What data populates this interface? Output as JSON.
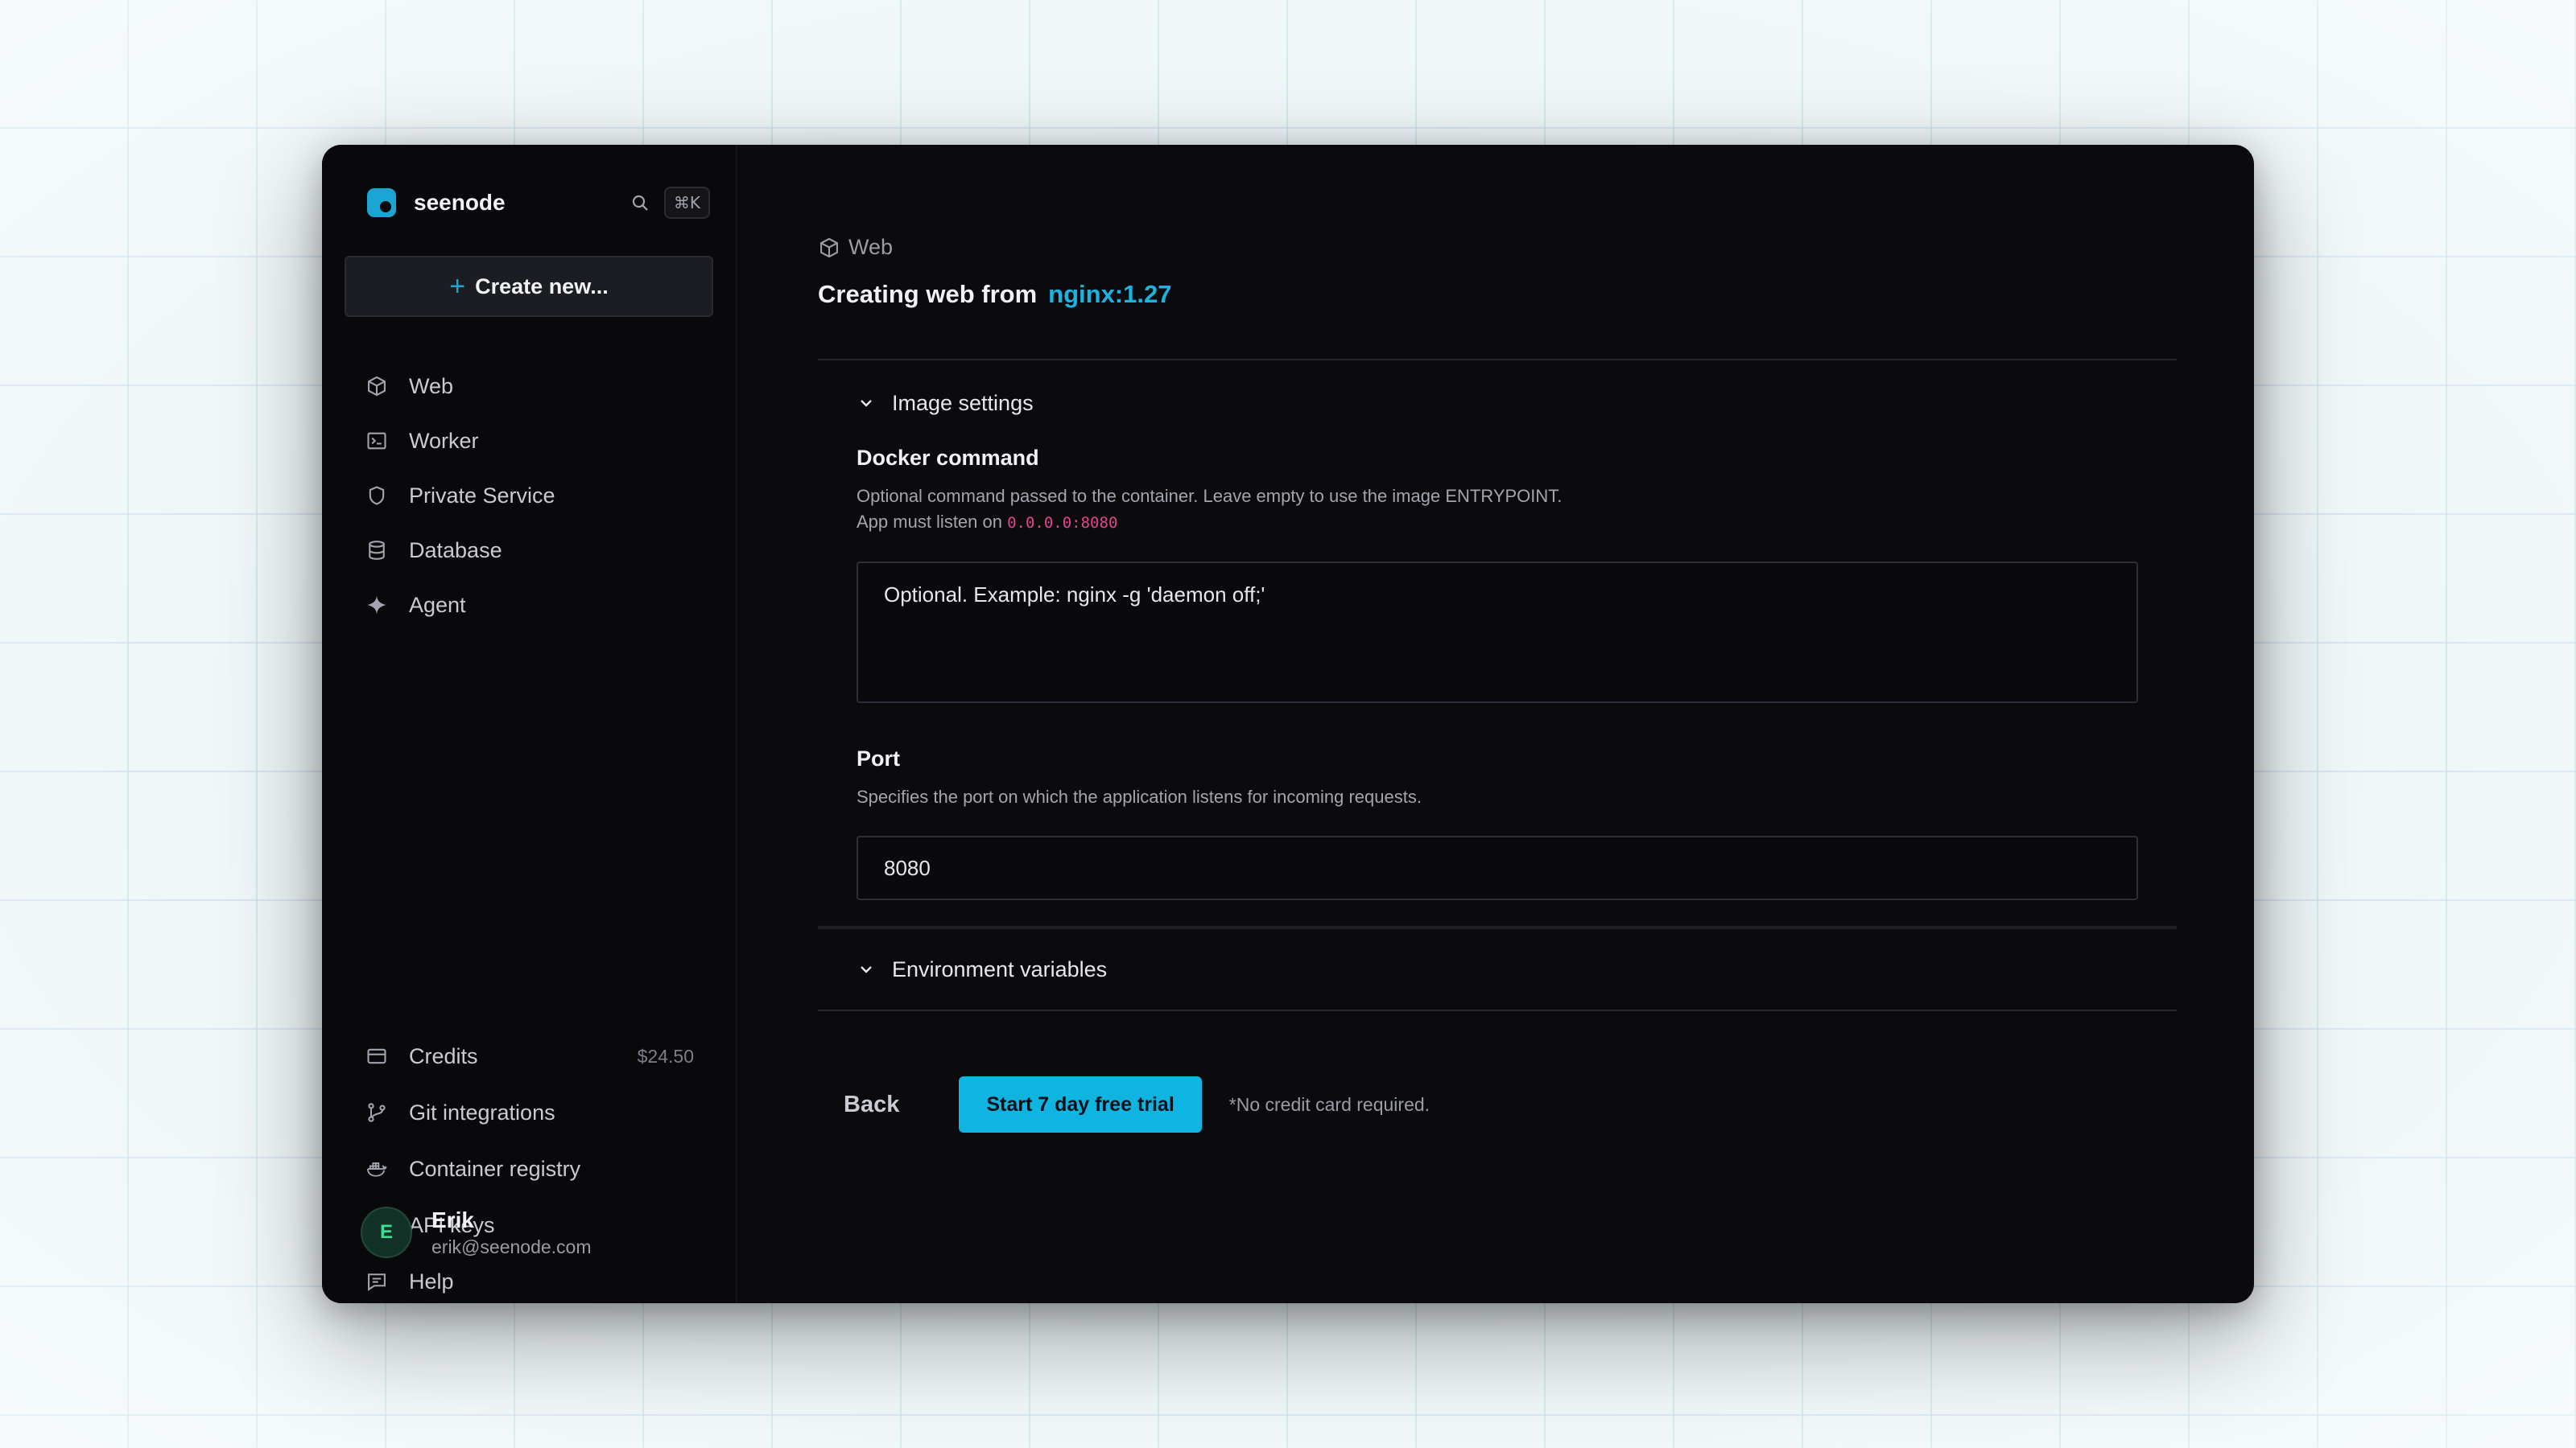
{
  "app": {
    "brand": "seenode",
    "shortcut": "⌘K",
    "accent_color": "#1ab4e0"
  },
  "sidebar": {
    "create_label": "Create new...",
    "items": [
      {
        "label": "Web",
        "icon": "cube-icon"
      },
      {
        "label": "Worker",
        "icon": "terminal-icon"
      },
      {
        "label": "Private Service",
        "icon": "shield-icon"
      },
      {
        "label": "Database",
        "icon": "database-icon"
      },
      {
        "label": "Agent",
        "icon": "sparkle-icon"
      }
    ],
    "bottom_items": [
      {
        "label": "Credits",
        "icon": "credit-card-icon",
        "value": "$24.50"
      },
      {
        "label": "Git integrations",
        "icon": "git-branch-icon"
      },
      {
        "label": "Container registry",
        "icon": "docker-icon"
      },
      {
        "label": "API keys",
        "icon": "key-icon"
      },
      {
        "label": "Help",
        "icon": "message-icon"
      }
    ],
    "user": {
      "initial": "E",
      "name": "Erik",
      "email": "erik@seenode.com"
    }
  },
  "main": {
    "breadcrumb": "Web",
    "title_prefix": "Creating web from",
    "title_image": "nginx:1.27",
    "image_settings_label": "Image settings",
    "docker": {
      "label": "Docker command",
      "help_line1": "Optional command passed to the container. Leave empty to use the image ENTRYPOINT.",
      "help_line2": "App must listen on",
      "listen_addr": "0.0.0.0:8080",
      "placeholder": "Optional. Example: nginx -g 'daemon off;'"
    },
    "port": {
      "label": "Port",
      "help": "Specifies the port on which the application listens for incoming requests.",
      "value": "8080"
    },
    "env_label": "Environment variables",
    "back_label": "Back",
    "trial_label": "Start 7 day free trial",
    "note": "*No credit card required."
  }
}
